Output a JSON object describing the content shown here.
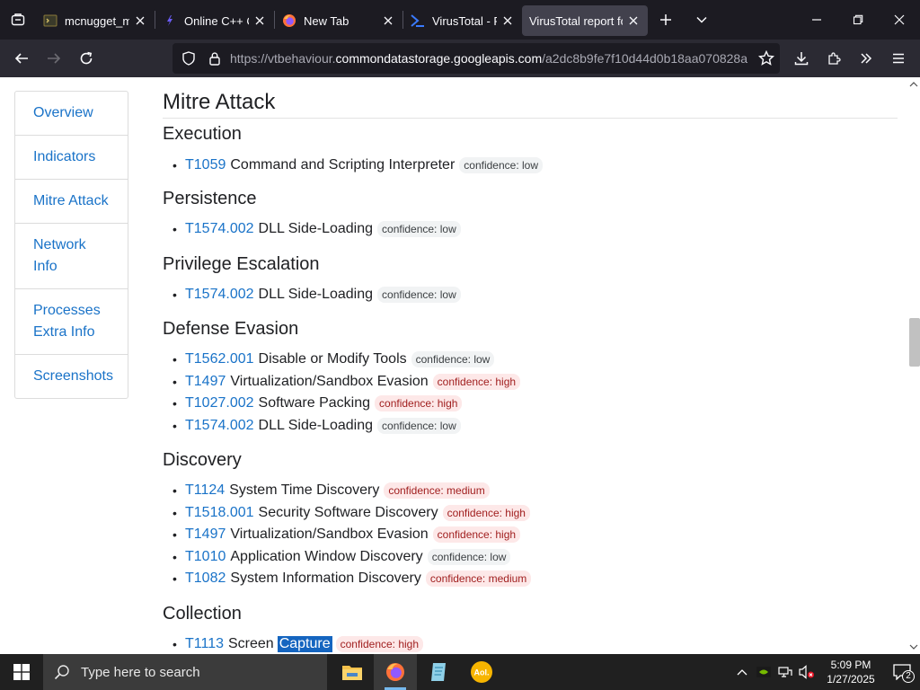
{
  "browser": {
    "tabs": [
      {
        "title": "mcnugget_mem",
        "icon": "terminal-icon"
      },
      {
        "title": "Online C++ Con",
        "icon": "code-icon"
      },
      {
        "title": "New Tab",
        "icon": "firefox-icon"
      },
      {
        "title": "VirusTotal - File -",
        "icon": "virustotal-icon"
      },
      {
        "title": "VirusTotal report for",
        "icon": "none",
        "active": true
      }
    ],
    "url_prefix": "https://vtbehaviour.",
    "url_host": "commondatastorage.googleapis.com",
    "url_rest": "/a2dc8b9fe7f10d44d0b18aa070828a"
  },
  "sidebar": {
    "items": [
      {
        "line1": "Overview",
        "line2": ""
      },
      {
        "line1": "Indicators",
        "line2": ""
      },
      {
        "line1": "Mitre Attack",
        "line2": ""
      },
      {
        "line1": "Network",
        "line2": "Info"
      },
      {
        "line1": "Processes",
        "line2": "Extra Info"
      },
      {
        "line1": "Screenshots",
        "line2": ""
      }
    ]
  },
  "main": {
    "title": "Mitre Attack",
    "sections": [
      {
        "name": "Execution",
        "items": [
          {
            "id": "T1059",
            "name": "Command and Scripting Interpreter",
            "confidence": "confidence: low",
            "level": "low"
          }
        ]
      },
      {
        "name": "Persistence",
        "items": [
          {
            "id": "T1574.002",
            "name": "DLL Side-Loading",
            "confidence": "confidence: low",
            "level": "low"
          }
        ]
      },
      {
        "name": "Privilege Escalation",
        "items": [
          {
            "id": "T1574.002",
            "name": "DLL Side-Loading",
            "confidence": "confidence: low",
            "level": "low"
          }
        ]
      },
      {
        "name": "Defense Evasion",
        "items": [
          {
            "id": "T1562.001",
            "name": "Disable or Modify Tools",
            "confidence": "confidence: low",
            "level": "low"
          },
          {
            "id": "T1497",
            "name": "Virtualization/Sandbox Evasion",
            "confidence": "confidence: high",
            "level": "high"
          },
          {
            "id": "T1027.002",
            "name": "Software Packing",
            "confidence": "confidence: high",
            "level": "high"
          },
          {
            "id": "T1574.002",
            "name": "DLL Side-Loading",
            "confidence": "confidence: low",
            "level": "low"
          }
        ]
      },
      {
        "name": "Discovery",
        "items": [
          {
            "id": "T1124",
            "name": "System Time Discovery",
            "confidence": "confidence: medium",
            "level": "medium"
          },
          {
            "id": "T1518.001",
            "name": "Security Software Discovery",
            "confidence": "confidence: high",
            "level": "high"
          },
          {
            "id": "T1497",
            "name": "Virtualization/Sandbox Evasion",
            "confidence": "confidence: high",
            "level": "high"
          },
          {
            "id": "T1010",
            "name": "Application Window Discovery",
            "confidence": "confidence: low",
            "level": "low"
          },
          {
            "id": "T1082",
            "name": "System Information Discovery",
            "confidence": "confidence: medium",
            "level": "medium"
          }
        ]
      },
      {
        "name": "Collection",
        "items": [
          {
            "id": "T1113",
            "name": "Screen",
            "name_selected": "Capture",
            "confidence": "confidence: high",
            "level": "high"
          }
        ]
      }
    ]
  },
  "taskbar": {
    "search_placeholder": "Type here to search",
    "time": "5:09 PM",
    "date": "1/27/2025",
    "notification_count": "2"
  },
  "colors": {
    "link": "#1a73c8",
    "badge_high_bg": "#fde8e8",
    "badge_low_bg": "#f1f3f4",
    "browser_dark": "#1c1b22"
  }
}
